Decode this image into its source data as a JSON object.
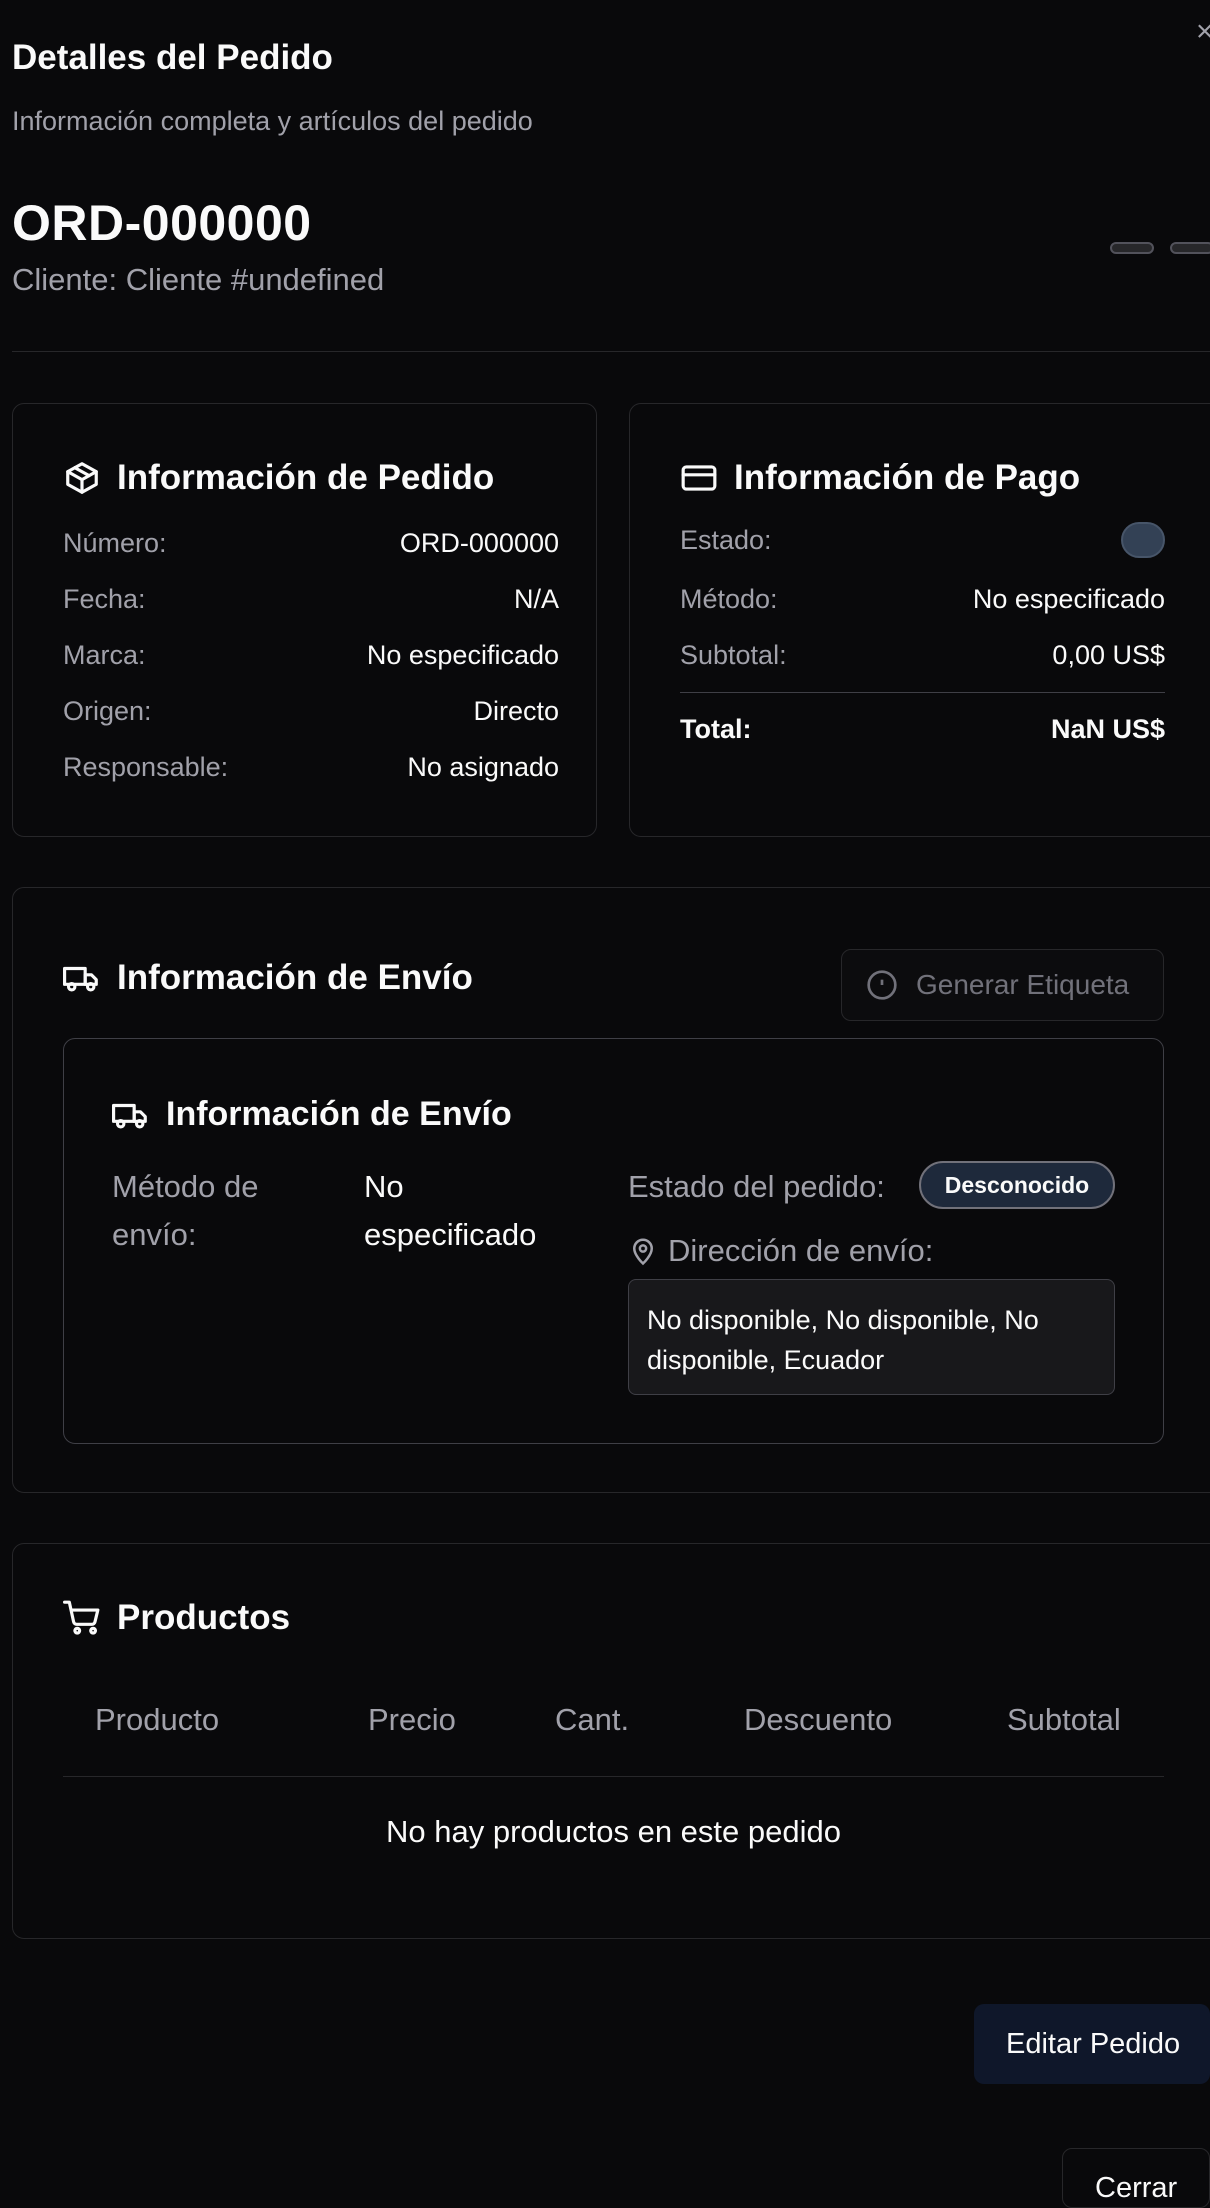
{
  "dialog": {
    "title": "Detalles del Pedido",
    "subtitle": "Información completa y artículos del pedido",
    "close_icon": "×"
  },
  "header": {
    "order_id": "ORD-000000",
    "client": "Cliente: Cliente #undefined"
  },
  "order_info": {
    "title": "Información de Pedido",
    "icon": "package-icon",
    "rows": [
      {
        "label": "Número:",
        "value": "ORD-000000"
      },
      {
        "label": "Fecha:",
        "value": "N/A"
      },
      {
        "label": "Marca:",
        "value": "No especificado"
      },
      {
        "label": "Origen:",
        "value": "Directo"
      },
      {
        "label": "Responsable:",
        "value": "No asignado"
      }
    ]
  },
  "payment_info": {
    "title": "Información de Pago",
    "icon": "credit-card-icon",
    "status_label": "Estado:",
    "method_label": "Método:",
    "method_value": "No especificado",
    "subtotal_label": "Subtotal:",
    "subtotal_value": "0,00 US$",
    "total_label": "Total:",
    "total_value": "NaN US$"
  },
  "shipping": {
    "title": "Información de Envío",
    "icon": "truck-icon",
    "generate_label_button": "Generar Etiqueta",
    "inner_title": "Información de Envío",
    "method_label_1": "Método de",
    "method_label_2": "envío:",
    "method_value_1": "No",
    "method_value_2": "especificado",
    "order_status_label": "Estado del pedido:",
    "order_status_badge": "Desconocido",
    "address_label": "Dirección de envío:",
    "address_value": "No disponible, No disponible, No disponible, Ecuador"
  },
  "products": {
    "title": "Productos",
    "icon": "shopping-cart-icon",
    "columns": [
      "Producto",
      "Precio",
      "Cant.",
      "Descuento",
      "Subtotal"
    ],
    "empty_message": "No hay productos en este pedido"
  },
  "footer": {
    "edit_button": "Editar Pedido",
    "close_button": "Cerrar"
  },
  "colors": {
    "background": "#09090b",
    "border": "#27272a",
    "muted_text": "#a1a1aa",
    "primary_button": "#0f172a"
  }
}
